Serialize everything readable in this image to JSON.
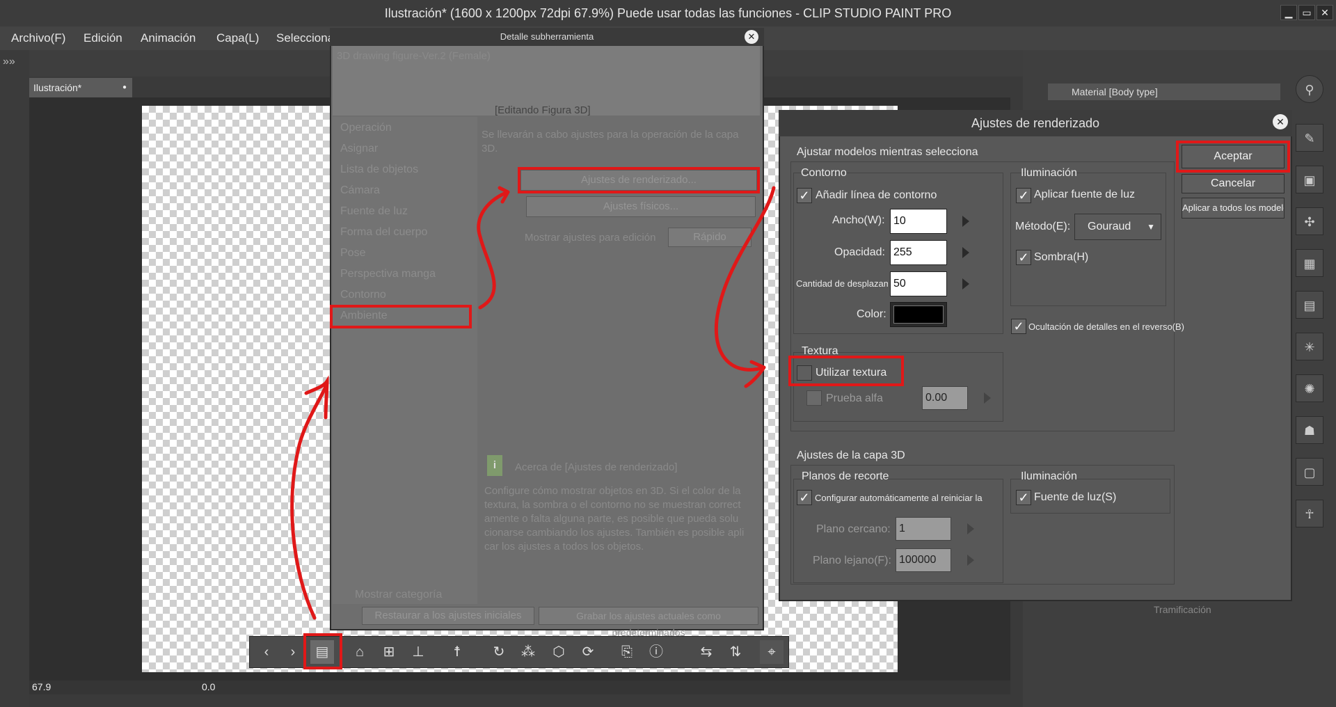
{
  "window": {
    "title": "Ilustración* (1600 x 1200px 72dpi 67.9%)  Puede usar todas las funciones - CLIP STUDIO PAINT PRO",
    "controls": [
      "▁",
      "▭",
      "✕"
    ]
  },
  "menu": [
    "Archivo(F)",
    "Edición",
    "Animación",
    "Capa(L)",
    "Selecciona"
  ],
  "doc_tab": {
    "label": "Ilustración*"
  },
  "status": {
    "zoom": "67.9",
    "rotation": "0.0"
  },
  "right_panel": {
    "tab": "Material [Body type]",
    "footer": "Tramificación"
  },
  "subtool_dialog": {
    "title": "Detalle subherramienta",
    "preview_name": "3D drawing figure-Ver.2 (Female)",
    "editing_label": "[Editando Figura 3D]",
    "categories": [
      "Operación",
      "Asignar",
      "Lista de objetos",
      "Cámara",
      "Fuente de luz",
      "Forma del cuerpo",
      "Pose",
      "Perspectiva manga",
      "Contorno",
      "Ambiente"
    ],
    "description": "Se llevarán a cabo ajustes para la operación de la capa 3D.",
    "render_button": "Ajustes de renderizado...",
    "physics_button": "Ajustes físicos...",
    "show_settings": "Mostrar ajustes para edición",
    "show_settings_value": "Rápido",
    "about_title": "Acerca de [Ajustes de renderizado]",
    "about_lines": [
      "Configure cómo mostrar objetos en 3D. Si el color de la",
      "textura, la sombra o el contorno no se muestran correct",
      "amente o falta alguna parte, es posible que pueda solu",
      "cionarse cambiando los ajustes. También es posible apli",
      "car los ajustes a todos los objetos."
    ],
    "show_category": "Mostrar categoría",
    "reset_button": "Restaurar a los ajustes iniciales",
    "save_default_button": "Grabar los ajustes actuales como predeterminados"
  },
  "render_dialog": {
    "title": "Ajustes de renderizado",
    "section_models": "Ajustar modelos mientras selecciona",
    "contour": {
      "title": "Contorno",
      "add_line": "Añadir línea de contorno",
      "width_label": "Ancho(W):",
      "width_value": "10",
      "opacity_label": "Opacidad:",
      "opacity_value": "255",
      "shift_label": "Cantidad de desplazami",
      "shift_value": "50",
      "color_label": "Color:",
      "color_value": "#000000"
    },
    "lighting": {
      "title": "Iluminación",
      "apply_light": "Aplicar fuente de luz",
      "method_label": "Método(E):",
      "method_value": "Gouraud",
      "shadow": "Sombra(H)"
    },
    "hide_back": "Ocultación de detalles en el reverso(B)",
    "texture": {
      "title": "Textura",
      "use_texture": "Utilizar textura",
      "alpha_test": "Prueba alfa",
      "alpha_value": "0.00"
    },
    "layer_section": "Ajustes de la capa 3D",
    "clipping": {
      "title": "Planos de recorte",
      "auto_config": "Configurar automáticamente al reiniciar la cán",
      "near_label": "Plano cercano:",
      "near_value": "1",
      "far_label": "Plano lejano(F):",
      "far_value": "100000"
    },
    "layer_lighting": {
      "title": "Iluminación",
      "light_source": "Fuente de luz(S)"
    },
    "accept": "Aceptar",
    "cancel": "Cancelar",
    "apply_all": "Aplicar a todos los modelo"
  },
  "colors": {
    "highlight": "#e01818",
    "dialog_bg": "#585858"
  }
}
